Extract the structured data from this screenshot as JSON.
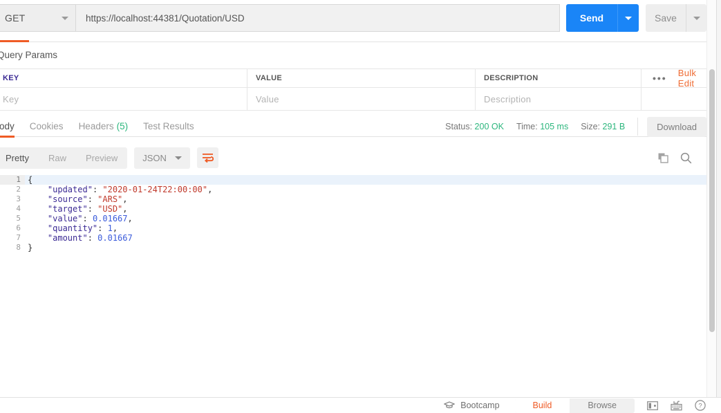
{
  "request": {
    "method": "GET",
    "method_caret_icon": "chevron-down-icon",
    "url": "https://localhost:44381/Quotation/USD",
    "send_label": "Send",
    "send_caret_icon": "chevron-down-icon",
    "save_label": "Save",
    "save_caret_icon": "chevron-down-icon"
  },
  "query_params": {
    "title": "Query Params",
    "columns": [
      "KEY",
      "VALUE",
      "DESCRIPTION"
    ],
    "rows": [
      {
        "key": "Key",
        "value": "Value",
        "description": "Description"
      }
    ],
    "more_icon": "ellipsis-icon",
    "bulk_edit_label": "Bulk Edit"
  },
  "response": {
    "tabs": [
      {
        "label": "Body",
        "active": true,
        "count": ""
      },
      {
        "label": "Cookies",
        "active": false,
        "count": ""
      },
      {
        "label": "Headers",
        "active": false,
        "count": "(5)"
      },
      {
        "label": "Test Results",
        "active": false,
        "count": ""
      }
    ],
    "meta": {
      "status_label": "Status:",
      "status_value": "200 OK",
      "time_label": "Time:",
      "time_value": "105 ms",
      "size_label": "Size:",
      "size_value": "291 B"
    },
    "download_label": "Download",
    "toolbar": {
      "formats": [
        {
          "label": "Pretty",
          "active": true
        },
        {
          "label": "Raw",
          "active": false
        },
        {
          "label": "Preview",
          "active": false
        }
      ],
      "language": "JSON",
      "language_caret_icon": "chevron-down-icon",
      "wrap_icon": "word-wrap-icon",
      "copy_icon": "copy-icon",
      "search_icon": "search-icon"
    },
    "body_lines": [
      {
        "n": "1",
        "tokens": [
          {
            "t": "p",
            "v": "{"
          }
        ],
        "fold": true
      },
      {
        "n": "2",
        "tokens": [
          {
            "t": "p",
            "v": "    "
          },
          {
            "t": "k",
            "v": "\"updated\""
          },
          {
            "t": "p",
            "v": ": "
          },
          {
            "t": "s",
            "v": "\"2020-01-24T22:00:00\""
          },
          {
            "t": "p",
            "v": ","
          }
        ]
      },
      {
        "n": "3",
        "tokens": [
          {
            "t": "p",
            "v": "    "
          },
          {
            "t": "k",
            "v": "\"source\""
          },
          {
            "t": "p",
            "v": ": "
          },
          {
            "t": "s",
            "v": "\"ARS\""
          },
          {
            "t": "p",
            "v": ","
          }
        ]
      },
      {
        "n": "4",
        "tokens": [
          {
            "t": "p",
            "v": "    "
          },
          {
            "t": "k",
            "v": "\"target\""
          },
          {
            "t": "p",
            "v": ": "
          },
          {
            "t": "s",
            "v": "\"USD\""
          },
          {
            "t": "p",
            "v": ","
          }
        ]
      },
      {
        "n": "5",
        "tokens": [
          {
            "t": "p",
            "v": "    "
          },
          {
            "t": "k",
            "v": "\"value\""
          },
          {
            "t": "p",
            "v": ": "
          },
          {
            "t": "n",
            "v": "0.01667"
          },
          {
            "t": "p",
            "v": ","
          }
        ]
      },
      {
        "n": "6",
        "tokens": [
          {
            "t": "p",
            "v": "    "
          },
          {
            "t": "k",
            "v": "\"quantity\""
          },
          {
            "t": "p",
            "v": ": "
          },
          {
            "t": "n",
            "v": "1"
          },
          {
            "t": "p",
            "v": ","
          }
        ]
      },
      {
        "n": "7",
        "tokens": [
          {
            "t": "p",
            "v": "    "
          },
          {
            "t": "k",
            "v": "\"amount\""
          },
          {
            "t": "p",
            "v": ": "
          },
          {
            "t": "n",
            "v": "0.01667"
          }
        ]
      },
      {
        "n": "8",
        "tokens": [
          {
            "t": "p",
            "v": "}"
          }
        ]
      }
    ]
  },
  "statusbar": {
    "bootcamp_icon": "graduation-cap-icon",
    "bootcamp_label": "Bootcamp",
    "modes": [
      {
        "label": "Build",
        "active": true
      },
      {
        "label": "Browse",
        "active": false
      }
    ],
    "layout_icon": "two-pane-layout-icon",
    "keyboard_icon": "keyboard-shortcuts-icon",
    "help_icon": "help-circle-icon"
  },
  "colors": {
    "accent_orange": "#ef5b25",
    "send_blue": "#1a85f7",
    "success_green": "#2cb67d"
  }
}
